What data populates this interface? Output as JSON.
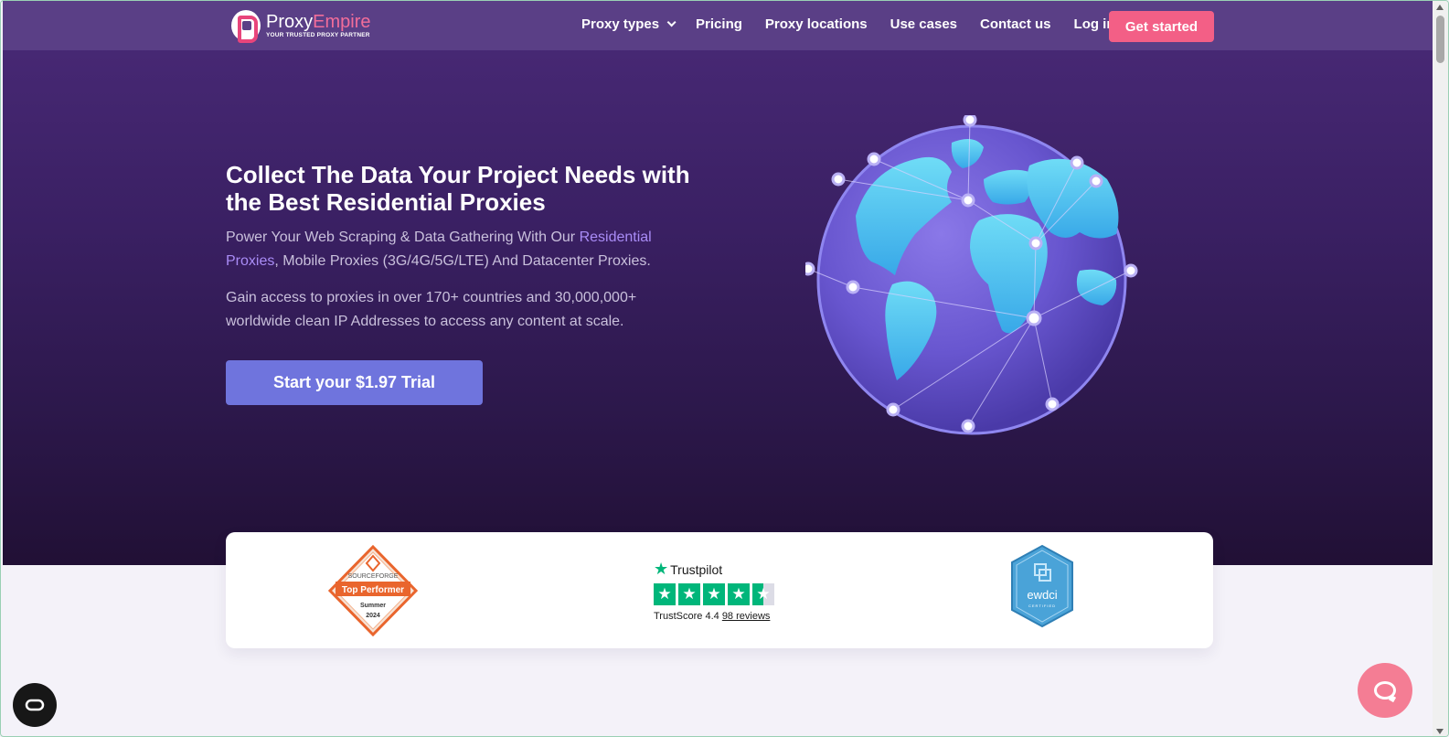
{
  "brand": {
    "name_part1": "Proxy",
    "name_part2": "Empire",
    "tagline": "YOUR TRUSTED PROXY PARTNER"
  },
  "nav": {
    "items": [
      {
        "label": "Proxy types",
        "dropdown": true
      },
      {
        "label": "Pricing"
      },
      {
        "label": "Proxy locations"
      },
      {
        "label": "Use cases"
      },
      {
        "label": "Contact us"
      },
      {
        "label": "Log in"
      }
    ],
    "cta": "Get started"
  },
  "hero": {
    "headline": "Collect The Data Your Project Needs with the Best Residential Proxies",
    "sub1_pre": "Power Your Web Scraping & Data Gathering With Our ",
    "sub1_link": "Residential Proxies",
    "sub1_post": ", Mobile Proxies (3G/4G/5G/LTE) And Datacenter Proxies.",
    "sub2": "Gain access to proxies in over 170+ countries and 30,000,000+ worldwide clean IP Addresses to access any content at scale.",
    "cta": "Start your $1.97 Trial"
  },
  "badges": {
    "sourceforge": {
      "brand": "SOURCEFORGE",
      "title": "Top Performer",
      "season": "Summer",
      "year": "2024"
    },
    "trustpilot": {
      "name": "Trustpilot",
      "score_label": "TrustScore",
      "score": "4.4",
      "reviews": "98 reviews"
    },
    "ewdci": {
      "name": "ewdci",
      "sub": "CERTIFIED"
    }
  },
  "icons": {
    "chat": "chat-icon",
    "accessibility": "accessibility-icon",
    "globe": "globe-illustration"
  },
  "colors": {
    "accent_pink": "#f35f86",
    "trial_button": "#6f74dd",
    "hero_dark": "#2b1749",
    "link_purple": "#a98cf6",
    "trustpilot_green": "#00b67a"
  }
}
